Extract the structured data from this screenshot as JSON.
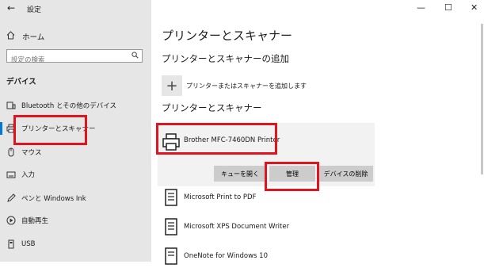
{
  "window": {
    "title": "設定",
    "minimize_glyph": "—",
    "maximize_glyph": "☐",
    "close_glyph": "✕"
  },
  "sidebar": {
    "back_glyph": "←",
    "home": {
      "label": "ホーム",
      "icon": "home-icon"
    },
    "search": {
      "placeholder": "設定の検索"
    },
    "section_label": "デバイス",
    "items": [
      {
        "label": "Bluetooth とその他のデバイス",
        "icon": "bluetooth-devices-icon"
      },
      {
        "label": "プリンターとスキャナー",
        "icon": "printer-icon"
      },
      {
        "label": "マウス",
        "icon": "mouse-icon"
      },
      {
        "label": "入力",
        "icon": "keyboard-icon"
      },
      {
        "label": "ペンと Windows Ink",
        "icon": "pen-icon"
      },
      {
        "label": "自動再生",
        "icon": "autoplay-icon"
      },
      {
        "label": "USB",
        "icon": "usb-icon"
      }
    ],
    "active_index": 1
  },
  "main": {
    "page_title": "プリンターとスキャナー",
    "add_section_title": "プリンターとスキャナーの追加",
    "add_button_label": "プリンターまたはスキャナーを追加します",
    "list_section_title": "プリンターとスキャナー",
    "selected_printer": {
      "name": "Brother MFC-7460DN Printer",
      "buttons": {
        "open_queue": "キューを開く",
        "manage": "管理",
        "remove": "デバイスの削除"
      }
    },
    "printers": [
      {
        "name": "Microsoft Print to PDF"
      },
      {
        "name": "Microsoft XPS Document Writer"
      },
      {
        "name": "OneNote for Windows 10"
      }
    ]
  },
  "colors": {
    "sidebar_bg": "#e6e6e6",
    "highlight_red": "#e0141e",
    "button_bg": "#cccccc",
    "selected_item_bg": "#f2f2f2"
  }
}
